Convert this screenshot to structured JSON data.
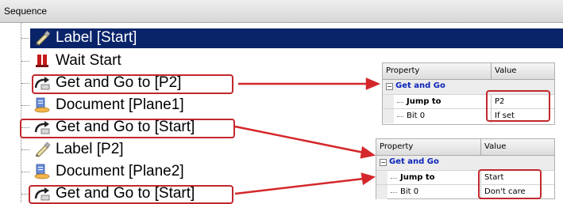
{
  "panel": {
    "title": "Sequence"
  },
  "tree": {
    "items": [
      {
        "label": "Label [Start]",
        "icon": "label-icon",
        "selected": true
      },
      {
        "label": "Wait Start",
        "icon": "wait-icon",
        "selected": false
      },
      {
        "label": "Get and Go to [P2]",
        "icon": "get-and-go-icon",
        "selected": false
      },
      {
        "label": "Document [Plane1]",
        "icon": "document-icon",
        "selected": false
      },
      {
        "label": "Get and Go to [Start]",
        "icon": "get-and-go-icon",
        "selected": false
      },
      {
        "label": "Label [P2]",
        "icon": "label-icon",
        "selected": false
      },
      {
        "label": "Document [Plane2]",
        "icon": "document-icon",
        "selected": false
      },
      {
        "label": "Get and Go to [Start]",
        "icon": "get-and-go-icon",
        "selected": false
      }
    ]
  },
  "property_grids": [
    {
      "header": {
        "property": "Property",
        "value": "Value"
      },
      "category": "Get and Go",
      "rows": [
        {
          "name": "Jump to",
          "value": "P2"
        },
        {
          "name": "Bit 0",
          "value": "If set"
        }
      ]
    },
    {
      "header": {
        "property": "Property",
        "value": "Value"
      },
      "category": "Get and Go",
      "rows": [
        {
          "name": "Jump to",
          "value": "Start"
        },
        {
          "name": "Bit 0",
          "value": "Don't care"
        }
      ]
    }
  ],
  "colors": {
    "selection": "#0a246a",
    "annotation_red": "#c0282d",
    "category_text": "#0a22b8"
  }
}
